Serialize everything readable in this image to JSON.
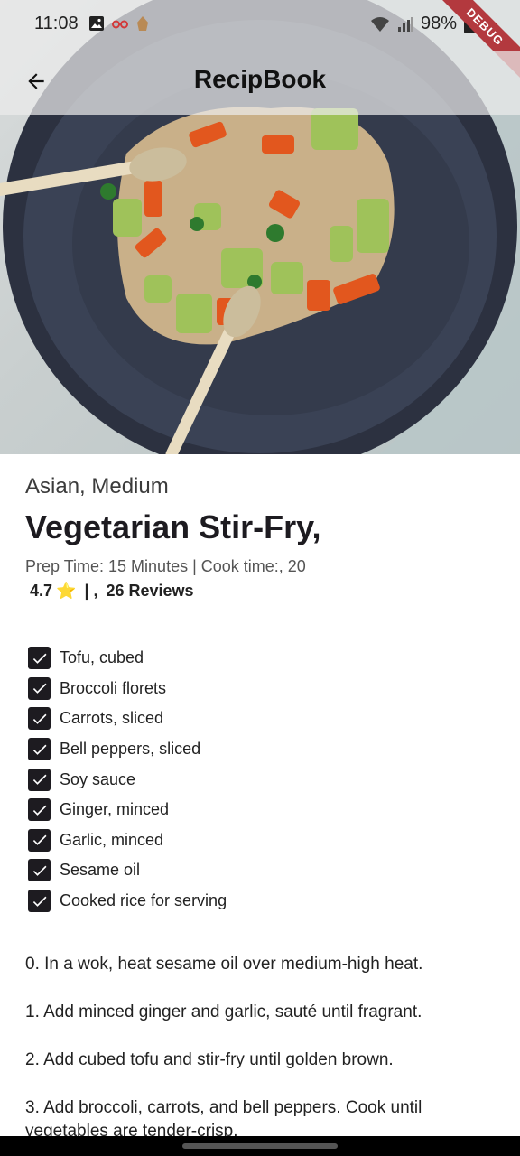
{
  "status_bar": {
    "time": "11:08",
    "battery": "98%"
  },
  "debug_banner": "DEBUG",
  "app_bar": {
    "title": "RecipBook"
  },
  "recipe": {
    "category": "Asian, Medium",
    "title": "Vegetarian Stir-Fry,",
    "times": "Prep Time: 15 Minutes | Cook time:,  20",
    "rating": "4.7",
    "rating_icon": "⭐",
    "separator": " | , ",
    "reviews": "26 Reviews"
  },
  "ingredients": [
    {
      "label": "Tofu, cubed",
      "checked": true
    },
    {
      "label": "Broccoli florets",
      "checked": true
    },
    {
      "label": "Carrots, sliced",
      "checked": true
    },
    {
      "label": "Bell peppers, sliced",
      "checked": true
    },
    {
      "label": "Soy sauce",
      "checked": true
    },
    {
      "label": "Ginger, minced",
      "checked": true
    },
    {
      "label": "Garlic, minced",
      "checked": true
    },
    {
      "label": "Sesame oil",
      "checked": true
    },
    {
      "label": "Cooked rice for serving",
      "checked": true
    }
  ],
  "steps": [
    "0. In a wok, heat sesame oil over medium-high heat.",
    "1. Add minced ginger and garlic, sauté until fragrant.",
    "2. Add cubed tofu and stir-fry until golden brown.",
    "3. Add broccoli, carrots, and bell peppers. Cook until vegetables are tender-crisp."
  ]
}
